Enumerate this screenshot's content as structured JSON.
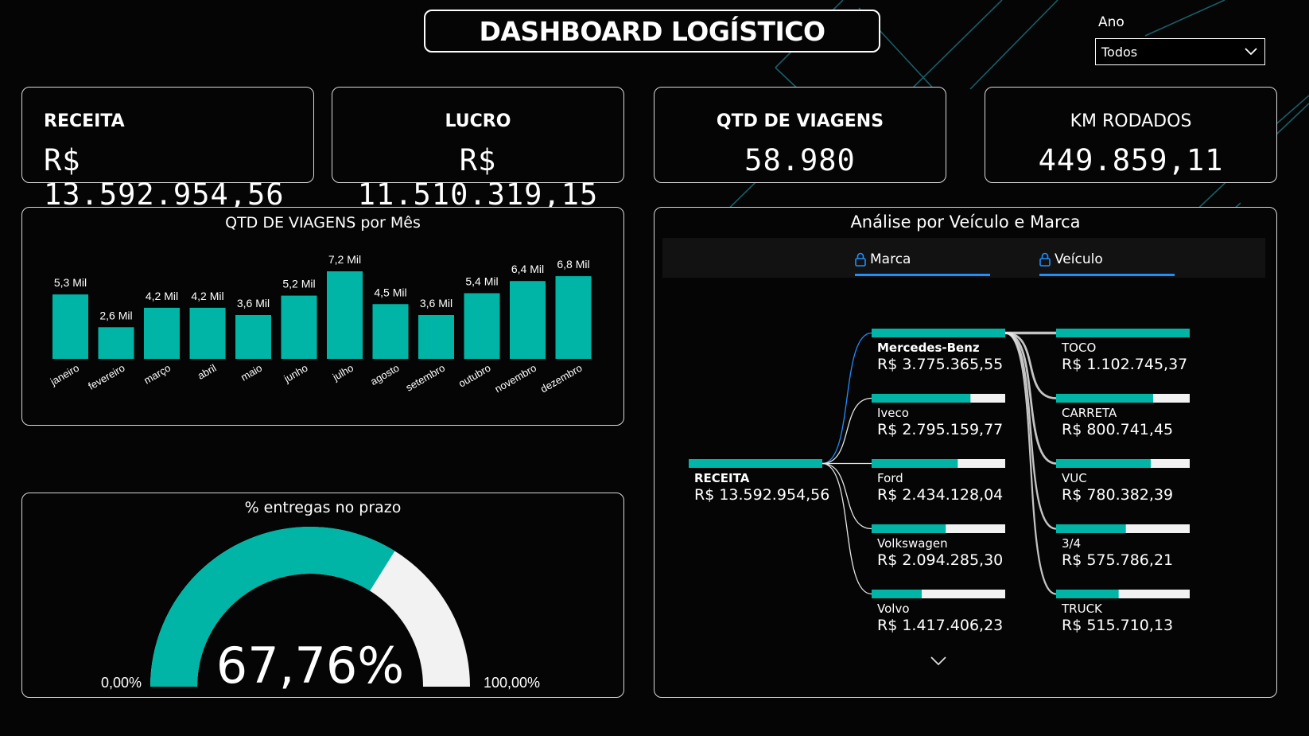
{
  "header": {
    "title": "DASHBOARD LOGÍSTICO"
  },
  "filter": {
    "label": "Ano",
    "selected": "Todos"
  },
  "kpis": [
    {
      "label": "RECEITA",
      "value": "R$ 13.592.954,56"
    },
    {
      "label": "LUCRO",
      "value": "R$ 11.510.319,15"
    },
    {
      "label": "QTD DE VIAGENS",
      "value": "58.980"
    },
    {
      "label": "KM RODADOS",
      "value": "449.859,11"
    }
  ],
  "colors": {
    "accent": "#00b5a6",
    "background": "#050505",
    "track": "#f2f2f2",
    "link": "#1f8fff"
  },
  "chart_data": [
    {
      "type": "bar",
      "title": "QTD DE VIAGENS por Mês",
      "categories": [
        "janeiro",
        "fevereiro",
        "março",
        "abril",
        "maio",
        "junho",
        "julho",
        "agosto",
        "setembro",
        "outubro",
        "novembro",
        "dezembro"
      ],
      "values": [
        5.3,
        2.6,
        4.2,
        4.2,
        3.6,
        5.2,
        7.2,
        4.5,
        3.6,
        5.4,
        6.4,
        6.8
      ],
      "labels": [
        "5,3 Mil",
        "2,6 Mil",
        "4,2 Mil",
        "4,2 Mil",
        "3,6 Mil",
        "5,2 Mil",
        "7,2 Mil",
        "4,5 Mil",
        "3,6 Mil",
        "5,4 Mil",
        "6,4 Mil",
        "6,8 Mil"
      ],
      "unit": "Mil",
      "ylim": [
        0,
        7.2
      ],
      "grid": false
    }
  ],
  "gauge": {
    "title": "% entregas no prazo",
    "value_label": "67,76%",
    "value": 0.6776,
    "min_label": "0,00%",
    "max_label": "100,00%"
  },
  "tree": {
    "title": "Análise por Veículo e Marca",
    "col_marca": "Marca",
    "col_veiculo": "Veículo",
    "root": {
      "name": "RECEITA",
      "value": "R$ 13.592.954,56"
    },
    "marcas": [
      {
        "name": "Mercedes-Benz",
        "value": "R$ 3.775.365,55",
        "fraction": 1.0,
        "selected": true
      },
      {
        "name": "Iveco",
        "value": "R$ 2.795.159,77",
        "fraction": 0.74
      },
      {
        "name": "Ford",
        "value": "R$ 2.434.128,04",
        "fraction": 0.645
      },
      {
        "name": "Volkswagen",
        "value": "R$ 2.094.285,30",
        "fraction": 0.555
      },
      {
        "name": "Volvo",
        "value": "R$ 1.417.406,23",
        "fraction": 0.375
      }
    ],
    "veiculos": [
      {
        "name": "TOCO",
        "value": "R$ 1.102.745,37",
        "fraction": 1.0
      },
      {
        "name": "CARRETA",
        "value": "R$ 800.741,45",
        "fraction": 0.726
      },
      {
        "name": "VUC",
        "value": "R$ 780.382,39",
        "fraction": 0.708
      },
      {
        "name": "3/4",
        "value": "R$ 575.786,21",
        "fraction": 0.522
      },
      {
        "name": "TRUCK",
        "value": "R$ 515.710,13",
        "fraction": 0.468
      }
    ]
  }
}
